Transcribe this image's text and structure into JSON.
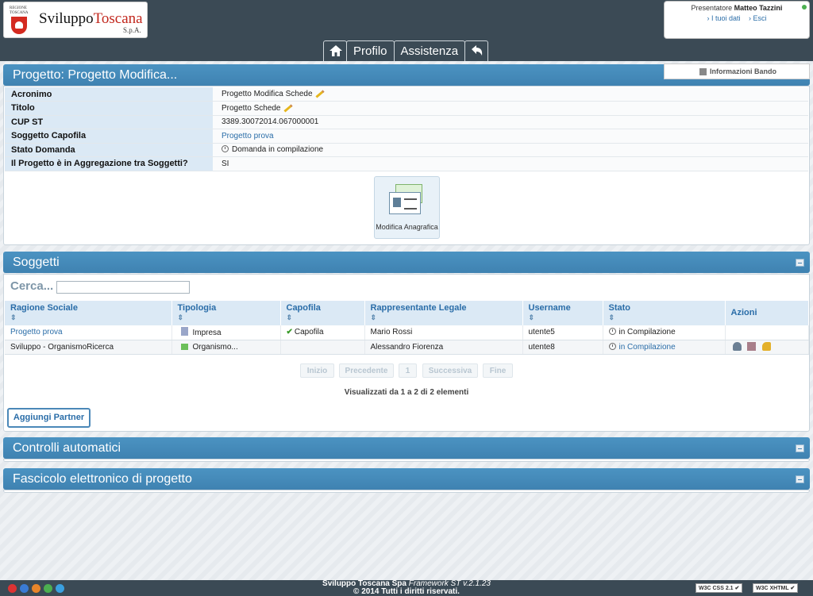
{
  "header": {
    "logo_small": "REGIONE TOSCANA",
    "logo_name_1": "Sviluppo",
    "logo_name_2": "Toscana",
    "logo_spa": "S.p.A.",
    "user_prefix": "Presentatore",
    "user_name": "Matteo Tazzini",
    "link_dati": "› I tuoi dati",
    "link_esci": "› Esci"
  },
  "nav": {
    "home_icon": "home-icon",
    "profilo": "Profilo",
    "assistenza": "Assistenza",
    "back_icon": "back-arrow-icon"
  },
  "info_bando": "Informazioni Bando",
  "progetto": {
    "title": "Progetto: Progetto Modifica...",
    "rows": [
      {
        "key": "Acronimo",
        "value": "Progetto Modifica Schede"
      },
      {
        "key": "Titolo",
        "value": "Progetto Schede"
      },
      {
        "key": "CUP ST",
        "value": "3389.30072014.067000001"
      },
      {
        "key": "Soggetto Capofila",
        "value": "Progetto prova"
      },
      {
        "key": "Stato Domanda",
        "value": "Domanda in compilazione"
      },
      {
        "key": "Il Progetto è in Aggregazione tra Soggetti?",
        "value": "SI"
      }
    ],
    "anagrafica_label": "Modifica Anagrafica"
  },
  "soggetti": {
    "title": "Soggetti",
    "cerca_label": "Cerca...",
    "cerca_value": "",
    "columns": [
      "Ragione Sociale",
      "Tipologia",
      "Capofila",
      "Rappresentante Legale",
      "Username",
      "Stato",
      "Azioni"
    ],
    "rows": [
      {
        "ragione": "Progetto prova",
        "tipologia": "Impresa",
        "capofila": "Capofila",
        "rappresentante": "Mario Rossi",
        "username": "utente5",
        "stato": "in Compilazione"
      },
      {
        "ragione": "Sviluppo - OrganismoRicerca",
        "tipologia": "Organismo...",
        "capofila": "",
        "rappresentante": "Alessandro Fiorenza",
        "username": "utente8",
        "stato": "in Compilazione"
      }
    ],
    "pager": {
      "inizio": "Inizio",
      "precedente": "Precedente",
      "page": "1",
      "successiva": "Successiva",
      "fine": "Fine"
    },
    "visualizzati": "Visualizzati da 1 a 2 di 2 elementi",
    "aggiungi": "Aggiungi Partner"
  },
  "controlli": {
    "title": "Controlli automatici"
  },
  "fascicolo": {
    "title": "Fascicolo elettronico di progetto"
  },
  "footer": {
    "line1_bold": "Sviluppo Toscana Spa",
    "line1_italic": "Framework ST v.2.1.23",
    "line2": "© 2014 Tutti i diritti riservati.",
    "badge_css": "W3C CSS 2.1 ✔",
    "badge_xhtml": "W3C XHTML ✔"
  }
}
